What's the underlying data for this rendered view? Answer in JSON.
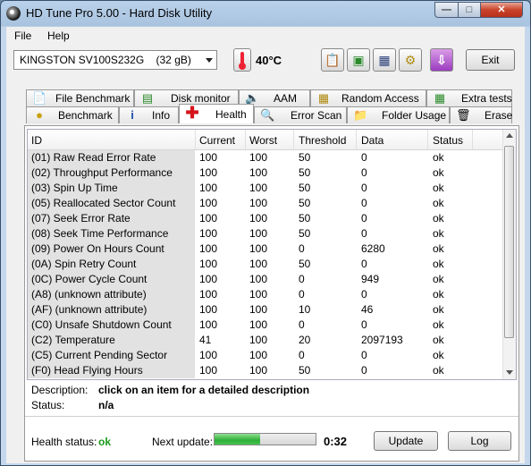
{
  "window": {
    "title": "HD Tune Pro 5.00 - Hard Disk Utility"
  },
  "menu": {
    "file": "File",
    "help": "Help"
  },
  "toolbar": {
    "drive": "KINGSTON SV100S232G    (32 gB)",
    "temperature": "40°C",
    "buttons": [
      {
        "icon": "copy-text-icon"
      },
      {
        "icon": "copy-screenshot-icon"
      },
      {
        "icon": "save-icon"
      },
      {
        "icon": "options-icon"
      },
      {
        "icon": "download-icon"
      }
    ],
    "exit_label": "Exit"
  },
  "tabs_row1": [
    {
      "label": "File Benchmark",
      "icon": "file-benchmark-icon"
    },
    {
      "label": "Disk monitor",
      "icon": "disk-monitor-icon"
    },
    {
      "label": "AAM",
      "icon": "speaker-icon"
    },
    {
      "label": "Random Access",
      "icon": "random-access-icon"
    },
    {
      "label": "Extra tests",
      "icon": "extra-tests-icon"
    }
  ],
  "tabs_row2": [
    {
      "label": "Benchmark",
      "icon": "benchmark-icon"
    },
    {
      "label": "Info",
      "icon": "info-icon"
    },
    {
      "label": "Health",
      "icon": "health-cross-icon",
      "active": true
    },
    {
      "label": "Error Scan",
      "icon": "magnifier-icon"
    },
    {
      "label": "Folder Usage",
      "icon": "folder-icon"
    },
    {
      "label": "Erase",
      "icon": "trash-icon"
    }
  ],
  "table": {
    "headers": [
      "ID",
      "Current",
      "Worst",
      "Threshold",
      "Data",
      "Status"
    ],
    "rows": [
      [
        "(01) Raw Read Error Rate",
        "100",
        "100",
        "50",
        "0",
        "ok"
      ],
      [
        "(02) Throughput Performance",
        "100",
        "100",
        "50",
        "0",
        "ok"
      ],
      [
        "(03) Spin Up Time",
        "100",
        "100",
        "50",
        "0",
        "ok"
      ],
      [
        "(05) Reallocated Sector Count",
        "100",
        "100",
        "50",
        "0",
        "ok"
      ],
      [
        "(07) Seek Error Rate",
        "100",
        "100",
        "50",
        "0",
        "ok"
      ],
      [
        "(08) Seek Time Performance",
        "100",
        "100",
        "50",
        "0",
        "ok"
      ],
      [
        "(09) Power On Hours Count",
        "100",
        "100",
        "0",
        "6280",
        "ok"
      ],
      [
        "(0A) Spin Retry Count",
        "100",
        "100",
        "50",
        "0",
        "ok"
      ],
      [
        "(0C) Power Cycle Count",
        "100",
        "100",
        "0",
        "949",
        "ok"
      ],
      [
        "(A8) (unknown attribute)",
        "100",
        "100",
        "0",
        "0",
        "ok"
      ],
      [
        "(AF) (unknown attribute)",
        "100",
        "100",
        "10",
        "46",
        "ok"
      ],
      [
        "(C0) Unsafe Shutdown Count",
        "100",
        "100",
        "0",
        "0",
        "ok"
      ],
      [
        "(C2) Temperature",
        "41",
        "100",
        "20",
        "2097193",
        "ok"
      ],
      [
        "(C5) Current Pending Sector",
        "100",
        "100",
        "0",
        "0",
        "ok"
      ],
      [
        "(F0) Head Flying Hours",
        "100",
        "100",
        "50",
        "0",
        "ok"
      ]
    ]
  },
  "details": {
    "description_label": "Description:",
    "description_value": "click on an item for a detailed description",
    "status_label": "Status:",
    "status_value": "n/a"
  },
  "footer": {
    "health_label": "Health status:",
    "health_value": "ok",
    "next_update_label": "Next update:",
    "next_update_progress": 0.45,
    "next_update_time": "0:32",
    "update_button": "Update",
    "log_button": "Log"
  },
  "colors": {
    "health_ok": "#1a9a1a",
    "progress": "#2fae3a"
  }
}
